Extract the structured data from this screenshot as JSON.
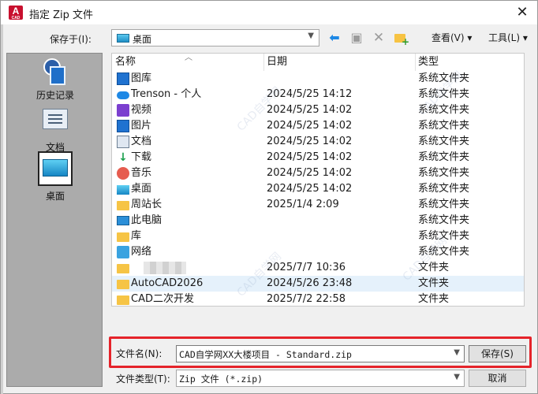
{
  "window": {
    "title": "指定 Zip 文件",
    "app_icon_letter": "A",
    "app_icon_sub": "CAD",
    "close_glyph": "✕"
  },
  "toolbar": {
    "save_in_label": "保存于(I):",
    "location": "桌面",
    "views_label": "查看(V)",
    "tools_label": "工具(L)",
    "icons": [
      "back-arrow-icon",
      "up-folder-icon",
      "delete-icon",
      "new-folder-icon"
    ]
  },
  "places": [
    {
      "label": "历史记录",
      "icon": "history-icon"
    },
    {
      "label": "文档",
      "icon": "documents-icon"
    },
    {
      "label": "桌面",
      "icon": "desktop-icon",
      "selected": true
    }
  ],
  "file_list": {
    "columns": [
      "名称",
      "日期",
      "类型"
    ],
    "rows": [
      {
        "name": "图库",
        "date": "",
        "type": "系统文件夹",
        "icon": "gallery-icon"
      },
      {
        "name": "Trenson - 个人",
        "date": "2024/5/25 14:12",
        "type": "系统文件夹",
        "icon": "cloud-icon"
      },
      {
        "name": "视频",
        "date": "2024/5/25 14:02",
        "type": "系统文件夹",
        "icon": "video-icon"
      },
      {
        "name": "图片",
        "date": "2024/5/25 14:02",
        "type": "系统文件夹",
        "icon": "pictures-icon"
      },
      {
        "name": "文档",
        "date": "2024/5/25 14:02",
        "type": "系统文件夹",
        "icon": "document-icon"
      },
      {
        "name": "下载",
        "date": "2024/5/25 14:02",
        "type": "系统文件夹",
        "icon": "download-icon"
      },
      {
        "name": "音乐",
        "date": "2024/5/25 14:02",
        "type": "系统文件夹",
        "icon": "music-icon"
      },
      {
        "name": "桌面",
        "date": "2024/5/25 14:02",
        "type": "系统文件夹",
        "icon": "desktop-icon"
      },
      {
        "name": "周站长",
        "date": "2025/1/4 2:09",
        "type": "系统文件夹",
        "icon": "folder-icon"
      },
      {
        "name": "此电脑",
        "date": "",
        "type": "系统文件夹",
        "icon": "computer-icon"
      },
      {
        "name": "库",
        "date": "",
        "type": "系统文件夹",
        "icon": "folder-icon"
      },
      {
        "name": "网络",
        "date": "",
        "type": "系统文件夹",
        "icon": "network-icon"
      },
      {
        "name": "",
        "date": "2025/7/7 10:36",
        "type": "文件夹",
        "icon": "folder-icon"
      },
      {
        "name": "AutoCAD2026",
        "date": "2024/5/26 23:48",
        "type": "文件夹",
        "icon": "folder-icon",
        "selected": true
      },
      {
        "name": "CAD二次开发",
        "date": "2025/7/2 22:58",
        "type": "文件夹",
        "icon": "folder-icon"
      }
    ]
  },
  "filename": {
    "label": "文件名(N):",
    "value": "CAD自学网XX大楼项目 - Standard.zip"
  },
  "filetype": {
    "label": "文件类型(T):",
    "value": "Zip 文件 (*.zip)"
  },
  "buttons": {
    "save": "保存(S)",
    "cancel": "取消"
  },
  "watermark": "CAD自学网"
}
